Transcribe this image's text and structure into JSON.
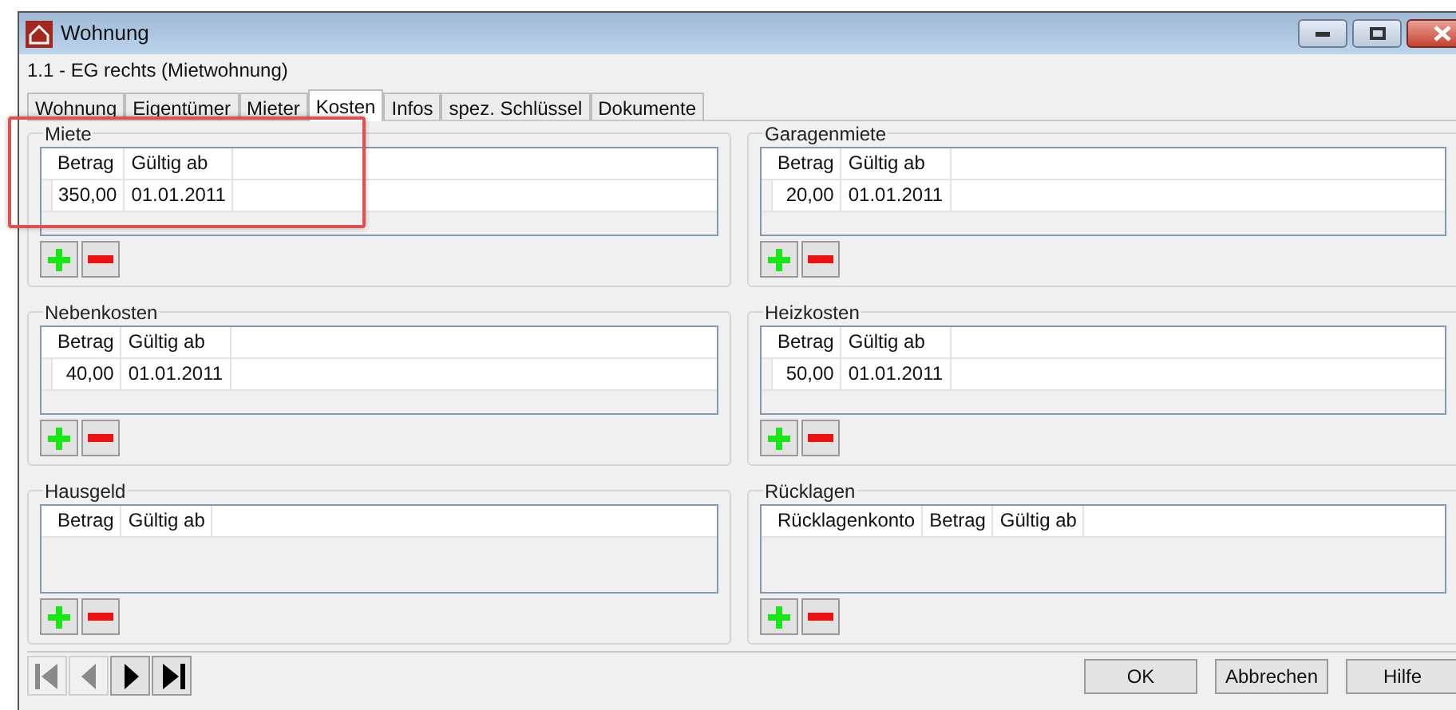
{
  "window": {
    "title": "Wohnung"
  },
  "subtitle": "1.1 - EG rechts (Mietwohnung)",
  "tabs": [
    {
      "label": "Wohnung",
      "selected": false
    },
    {
      "label": "Eigentümer",
      "selected": false
    },
    {
      "label": "Mieter",
      "selected": false
    },
    {
      "label": "Kosten",
      "selected": true
    },
    {
      "label": "Infos",
      "selected": false
    },
    {
      "label": "spez. Schlüssel",
      "selected": false
    },
    {
      "label": "Dokumente",
      "selected": false
    }
  ],
  "groups": [
    {
      "title": "Miete",
      "highlighted": true,
      "columns": [
        "Betrag",
        "Gültig ab"
      ],
      "rows": [
        [
          "350,00",
          "01.01.2011"
        ]
      ]
    },
    {
      "title": "Garagenmiete",
      "highlighted": false,
      "columns": [
        "Betrag",
        "Gültig ab"
      ],
      "rows": [
        [
          "20,00",
          "01.01.2011"
        ]
      ]
    },
    {
      "title": "Nebenkosten",
      "highlighted": false,
      "columns": [
        "Betrag",
        "Gültig ab"
      ],
      "rows": [
        [
          "40,00",
          "01.01.2011"
        ]
      ]
    },
    {
      "title": "Heizkosten",
      "highlighted": false,
      "columns": [
        "Betrag",
        "Gültig ab"
      ],
      "rows": [
        [
          "50,00",
          "01.01.2011"
        ]
      ]
    },
    {
      "title": "Hausgeld",
      "highlighted": false,
      "columns": [
        "Betrag",
        "Gültig ab"
      ]
    },
    {
      "title": "Rücklagen",
      "highlighted": false,
      "columns": [
        "Rücklagenkonto",
        "Betrag",
        "Gültig ab"
      ]
    }
  ],
  "navigation": [
    {
      "kind": "first",
      "disabled": true
    },
    {
      "kind": "previous",
      "disabled": true
    },
    {
      "kind": "next",
      "disabled": false
    },
    {
      "kind": "last",
      "disabled": false
    }
  ],
  "buttons": [
    "OK",
    "Abbrechen",
    "Hilfe"
  ]
}
